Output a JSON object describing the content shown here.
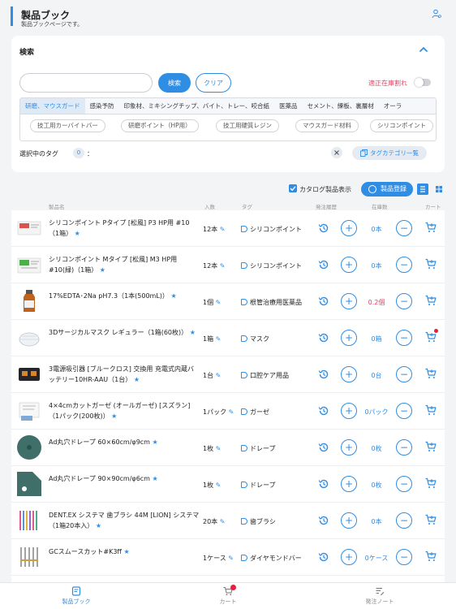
{
  "header": {
    "title": "製品ブック",
    "subtitle": "製品ブックページです。"
  },
  "search": {
    "title": "検索",
    "input_value": "",
    "input_placeholder": "",
    "search_label": "検索",
    "clear_label": "クリア",
    "proper_stock_label": "適正在庫割れ",
    "proper_stock_on": false
  },
  "categories": {
    "tabs": [
      "研磨、マウスガード",
      "感染予防",
      "印象材、ミキシングチップ、バイト、トレー、咬合紙",
      "医薬品",
      "セメント、練板、裏層材",
      "オーラ"
    ],
    "active_index": 0,
    "chips": [
      "技工用カーバイトバー",
      "研磨ポイント（HP用）",
      "技工用硬質レジン",
      "マウスガード材料",
      "シリコンポイント"
    ]
  },
  "selected_tags": {
    "label": "選択中のタグ",
    "count": "0",
    "colon": "：",
    "tag_category_label": "タグカテゴリ一覧"
  },
  "toolbar": {
    "catalog_label": "カタログ製品表示",
    "catalog_checked": true,
    "register_label": "製品登録"
  },
  "columns": {
    "name": "製品名",
    "qty": "入数",
    "tag": "タグ",
    "history": "発注履歴",
    "stock": "在庫数",
    "cart": "カート"
  },
  "products": [
    {
      "name": "シリコンポイント Pタイプ [松風] P3 HP用 #10（1箱）",
      "qty": "12本",
      "tag": "シリコンポイント",
      "stock": "0本",
      "stock_alert": false,
      "in_cart": false,
      "thumb": "silicone-point-box"
    },
    {
      "name": "シリコンポイント Mタイプ [松風] M3 HP用 #10(緑)（1箱）",
      "qty": "12本",
      "tag": "シリコンポイント",
      "stock": "0本",
      "stock_alert": false,
      "in_cart": false,
      "thumb": "silicone-point-box-green"
    },
    {
      "name": "17%EDTA･2Na pH7.3（1本(500mL)）",
      "qty": "1個",
      "tag": "根管治療用医薬品",
      "stock": "0.2個",
      "stock_alert": true,
      "in_cart": false,
      "thumb": "medicine-bottle"
    },
    {
      "name": "3Dサージカルマスク レギュラー（1箱(60枚)）",
      "qty": "1箱",
      "tag": "マスク",
      "stock": "0箱",
      "stock_alert": false,
      "in_cart": true,
      "thumb": "mask"
    },
    {
      "name": "3電源吸引器 [ブルークロス] 交換用 充電式内蔵バッテリー10HR-AAU（1台）",
      "qty": "1台",
      "tag": "口腔ケア用品",
      "stock": "0台",
      "stock_alert": false,
      "in_cart": false,
      "thumb": "battery"
    },
    {
      "name": "4×4cmカットガーゼ (オールガーゼ) [スズラン]（1パック(200枚)）",
      "qty": "1パック",
      "tag": "ガーゼ",
      "stock": "0パック",
      "stock_alert": false,
      "in_cart": false,
      "thumb": "gauze"
    },
    {
      "name": "Ad丸穴ドレープ 60×60cm/φ9cm",
      "qty": "1枚",
      "tag": "ドレープ",
      "stock": "0枚",
      "stock_alert": false,
      "in_cart": false,
      "thumb": "drape-round"
    },
    {
      "name": "Ad丸穴ドレープ 90×90cm/φ6cm",
      "qty": "1枚",
      "tag": "ドレープ",
      "stock": "0枚",
      "stock_alert": false,
      "in_cart": false,
      "thumb": "drape-square"
    },
    {
      "name": "DENT.EX システマ 歯ブラシ 44M [LION] システマ（1箱20本入）",
      "qty": "20本",
      "tag": "歯ブラシ",
      "stock": "0本",
      "stock_alert": false,
      "in_cart": false,
      "thumb": "toothbrushes"
    },
    {
      "name": "GCスムースカット#K3ff",
      "qty": "1ケース",
      "tag": "ダイヤモンドバー",
      "stock": "0ケース",
      "stock_alert": false,
      "in_cart": false,
      "thumb": "burs"
    }
  ],
  "tabbar": {
    "items": [
      "製品ブック",
      "カート",
      "発注ノート"
    ],
    "active_index": 0,
    "cart_has_items": true
  },
  "colors": {
    "accent": "#2f8de4",
    "alert": "#e04462",
    "badge": "#e0223a"
  }
}
